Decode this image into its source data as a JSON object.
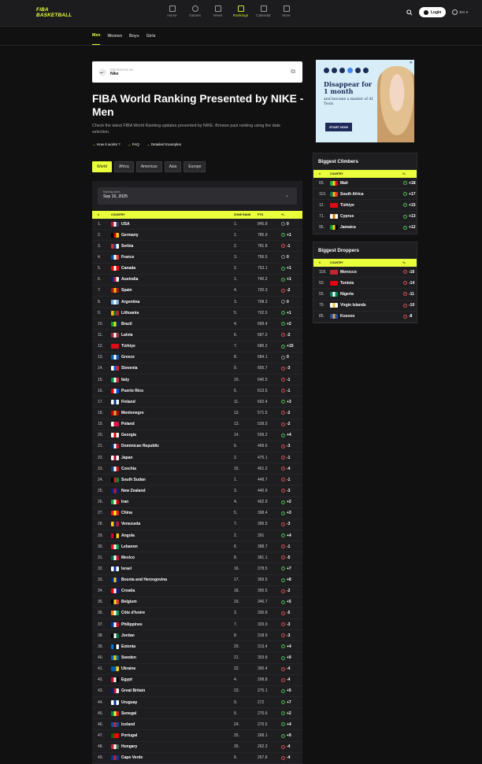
{
  "brand": {
    "line1": "FIBA",
    "line2": "BASKETBALL"
  },
  "nav": [
    {
      "label": "Home",
      "icon": "home-icon"
    },
    {
      "label": "Games",
      "icon": "ball-icon"
    },
    {
      "label": "News",
      "icon": "news-icon"
    },
    {
      "label": "Rankings",
      "icon": "rankings-icon",
      "active": true
    },
    {
      "label": "Calendar",
      "icon": "calendar-icon"
    },
    {
      "label": "More",
      "icon": "more-icon"
    }
  ],
  "header": {
    "login_label": "Login",
    "lang_label": "EN"
  },
  "subnav": [
    {
      "label": "Men",
      "active": true
    },
    {
      "label": "Women"
    },
    {
      "label": "Boys"
    },
    {
      "label": "Girls"
    }
  ],
  "sponsor": {
    "label": "PRESENTED BY",
    "name": "Nike"
  },
  "page": {
    "title": "FIBA World Ranking Presented by NIKE - Men",
    "description": "Check the latest FIBA World Ranking updates presented by NIKE. Browse past ranking using the date selection.",
    "links": [
      "How it works ?",
      "FAQ",
      "Detailed Examples"
    ]
  },
  "regions": [
    {
      "label": "World",
      "active": true
    },
    {
      "label": "Africa"
    },
    {
      "label": "Americas"
    },
    {
      "label": "Asia"
    },
    {
      "label": "Europe"
    }
  ],
  "ranking_date": {
    "label": "Ranking dates",
    "value": "Sep 15, 2025"
  },
  "table": {
    "headers": [
      "#",
      "COUNTRY",
      "ZONE RANK",
      "PTS",
      "+/-"
    ],
    "rows": [
      {
        "rank": "1.",
        "country": "USA",
        "zone": "1.",
        "pts": "845.8",
        "chg": "0",
        "flag": [
          "#b22234",
          "#ffffff",
          "#3c3b6e"
        ]
      },
      {
        "rank": "2.",
        "country": "Germany",
        "zone": "1.",
        "pts": "785.9",
        "chg": "+1",
        "flag": [
          "#000000",
          "#dd0000",
          "#ffce00"
        ]
      },
      {
        "rank": "3.",
        "country": "Serbia",
        "zone": "2.",
        "pts": "781.8",
        "chg": "-1",
        "flag": [
          "#c6363c",
          "#0c4076",
          "#ffffff"
        ]
      },
      {
        "rank": "4.",
        "country": "France",
        "zone": "3.",
        "pts": "756.5",
        "chg": "0",
        "flag": [
          "#0055a4",
          "#ffffff",
          "#ef4135"
        ]
      },
      {
        "rank": "5.",
        "country": "Canada",
        "zone": "2.",
        "pts": "753.1",
        "chg": "+1",
        "flag": [
          "#ff0000",
          "#ffffff",
          "#ff0000"
        ]
      },
      {
        "rank": "6.",
        "country": "Australia",
        "zone": "1.",
        "pts": "740.2",
        "chg": "+1",
        "flag": [
          "#00247d",
          "#cf142b",
          "#ffffff"
        ]
      },
      {
        "rank": "7.",
        "country": "Spain",
        "zone": "4.",
        "pts": "720.3",
        "chg": "-2",
        "flag": [
          "#aa151b",
          "#f1bf00",
          "#aa151b"
        ]
      },
      {
        "rank": "8.",
        "country": "Argentina",
        "zone": "3.",
        "pts": "708.3",
        "chg": "0",
        "flag": [
          "#74acdf",
          "#ffffff",
          "#74acdf"
        ]
      },
      {
        "rank": "9.",
        "country": "Lithuania",
        "zone": "5.",
        "pts": "702.5",
        "chg": "+1",
        "flag": [
          "#fdb913",
          "#006a44",
          "#c1272d"
        ]
      },
      {
        "rank": "10.",
        "country": "Brazil",
        "zone": "4.",
        "pts": "699.4",
        "chg": "+2",
        "flag": [
          "#009c3b",
          "#ffdf00",
          "#002776"
        ]
      },
      {
        "rank": "11.",
        "country": "Latvia",
        "zone": "6.",
        "pts": "687.2",
        "chg": "-2",
        "flag": [
          "#9e3039",
          "#ffffff",
          "#9e3039"
        ]
      },
      {
        "rank": "12.",
        "country": "Türkiye",
        "zone": "7.",
        "pts": "686.2",
        "chg": "+15",
        "flag": [
          "#e30a17",
          "#e30a17",
          "#e30a17"
        ]
      },
      {
        "rank": "13.",
        "country": "Greece",
        "zone": "8.",
        "pts": "684.1",
        "chg": "0",
        "flag": [
          "#0d5eaf",
          "#ffffff",
          "#0d5eaf"
        ]
      },
      {
        "rank": "14.",
        "country": "Slovenia",
        "zone": "9.",
        "pts": "655.7",
        "chg": "-3",
        "flag": [
          "#ffffff",
          "#005ce5",
          "#ed1c24"
        ]
      },
      {
        "rank": "15.",
        "country": "Italy",
        "zone": "10.",
        "pts": "640.5",
        "chg": "-1",
        "flag": [
          "#009246",
          "#ffffff",
          "#ce2b37"
        ]
      },
      {
        "rank": "16.",
        "country": "Puerto Rico",
        "zone": "5.",
        "pts": "613.5",
        "chg": "-1",
        "flag": [
          "#ed0000",
          "#ffffff",
          "#0050f0"
        ]
      },
      {
        "rank": "17.",
        "country": "Finland",
        "zone": "11.",
        "pts": "602.4",
        "chg": "+3",
        "flag": [
          "#ffffff",
          "#003580",
          "#ffffff"
        ]
      },
      {
        "rank": "18.",
        "country": "Montenegro",
        "zone": "12.",
        "pts": "571.5",
        "chg": "-2",
        "flag": [
          "#c40308",
          "#d4af37",
          "#c40308"
        ]
      },
      {
        "rank": "19.",
        "country": "Poland",
        "zone": "13.",
        "pts": "539.5",
        "chg": "-2",
        "flag": [
          "#ffffff",
          "#dc143c",
          "#dc143c"
        ]
      },
      {
        "rank": "20.",
        "country": "Georgia",
        "zone": "14.",
        "pts": "509.2",
        "chg": "+4",
        "flag": [
          "#ffffff",
          "#ff0000",
          "#ffffff"
        ]
      },
      {
        "rank": "21.",
        "country": "Dominican Republic",
        "zone": "6.",
        "pts": "499.6",
        "chg": "-3",
        "flag": [
          "#002d62",
          "#ffffff",
          "#ce1126"
        ]
      },
      {
        "rank": "22.",
        "country": "Japan",
        "zone": "2.",
        "pts": "475.1",
        "chg": "-1",
        "flag": [
          "#ffffff",
          "#bc002d",
          "#ffffff"
        ]
      },
      {
        "rank": "23.",
        "country": "Czechia",
        "zone": "15.",
        "pts": "451.2",
        "chg": "-4",
        "flag": [
          "#11457e",
          "#ffffff",
          "#d7141a"
        ]
      },
      {
        "rank": "24.",
        "country": "South Sudan",
        "zone": "1.",
        "pts": "448.7",
        "chg": "-1",
        "flag": [
          "#000000",
          "#da121a",
          "#078930"
        ]
      },
      {
        "rank": "25.",
        "country": "New Zealand",
        "zone": "3.",
        "pts": "440.9",
        "chg": "-3",
        "flag": [
          "#00247d",
          "#cc142b",
          "#00247d"
        ]
      },
      {
        "rank": "26.",
        "country": "Iran",
        "zone": "4.",
        "pts": "402.9",
        "chg": "+2",
        "flag": [
          "#239f40",
          "#ffffff",
          "#da0000"
        ]
      },
      {
        "rank": "27.",
        "country": "China",
        "zone": "5.",
        "pts": "398.4",
        "chg": "+3",
        "flag": [
          "#ee1c25",
          "#ffff00",
          "#ee1c25"
        ]
      },
      {
        "rank": "28.",
        "country": "Venezuela",
        "zone": "7.",
        "pts": "395.5",
        "chg": "-3",
        "flag": [
          "#ffcc00",
          "#00247d",
          "#cf142b"
        ]
      },
      {
        "rank": "29.",
        "country": "Angola",
        "zone": "2.",
        "pts": "391",
        "chg": "+4",
        "flag": [
          "#cc092f",
          "#000000",
          "#ffcb00"
        ]
      },
      {
        "rank": "30.",
        "country": "Lebanon",
        "zone": "6.",
        "pts": "388.7",
        "chg": "-1",
        "flag": [
          "#ee161f",
          "#ffffff",
          "#00a651"
        ]
      },
      {
        "rank": "31.",
        "country": "Mexico",
        "zone": "8.",
        "pts": "381.1",
        "chg": "-5",
        "flag": [
          "#006847",
          "#ffffff",
          "#ce1126"
        ]
      },
      {
        "rank": "32.",
        "country": "Israel",
        "zone": "16.",
        "pts": "378.5",
        "chg": "+7",
        "flag": [
          "#ffffff",
          "#0038b8",
          "#ffffff"
        ]
      },
      {
        "rank": "33.",
        "country": "Bosnia and Herzegovina",
        "zone": "17.",
        "pts": "369.5",
        "chg": "+8",
        "flag": [
          "#002395",
          "#fecb00",
          "#002395"
        ]
      },
      {
        "rank": "34.",
        "country": "Croatia",
        "zone": "18.",
        "pts": "350.5",
        "chg": "-2",
        "flag": [
          "#ff0000",
          "#ffffff",
          "#171796"
        ]
      },
      {
        "rank": "35.",
        "country": "Belgium",
        "zone": "19.",
        "pts": "346.7",
        "chg": "+5",
        "flag": [
          "#000000",
          "#fdda24",
          "#ef3340"
        ]
      },
      {
        "rank": "36.",
        "country": "Côte d'Ivoire",
        "zone": "3.",
        "pts": "330.8",
        "chg": "-5",
        "flag": [
          "#f77f00",
          "#ffffff",
          "#009e60"
        ]
      },
      {
        "rank": "37.",
        "country": "Philippines",
        "zone": "7.",
        "pts": "329.9",
        "chg": "-3",
        "flag": [
          "#0038a8",
          "#ffffff",
          "#ce1126"
        ]
      },
      {
        "rank": "38.",
        "country": "Jordan",
        "zone": "8.",
        "pts": "318.9",
        "chg": "-3",
        "flag": [
          "#000000",
          "#ffffff",
          "#007a3d"
        ]
      },
      {
        "rank": "39.",
        "country": "Estonia",
        "zone": "20.",
        "pts": "313.4",
        "chg": "+4",
        "flag": [
          "#0072ce",
          "#000000",
          "#ffffff"
        ]
      },
      {
        "rank": "40.",
        "country": "Sweden",
        "zone": "21.",
        "pts": "303.8",
        "chg": "+9",
        "flag": [
          "#006aa7",
          "#fecc00",
          "#006aa7"
        ]
      },
      {
        "rank": "41.",
        "country": "Ukraine",
        "zone": "22.",
        "pts": "300.4",
        "chg": "-4",
        "flag": [
          "#0057b7",
          "#0057b7",
          "#ffd700"
        ]
      },
      {
        "rank": "42.",
        "country": "Egypt",
        "zone": "4.",
        "pts": "298.8",
        "chg": "-4",
        "flag": [
          "#ce1126",
          "#ffffff",
          "#000000"
        ]
      },
      {
        "rank": "43.",
        "country": "Great Britain",
        "zone": "23.",
        "pts": "275.1",
        "chg": "+5",
        "flag": [
          "#012169",
          "#c8102e",
          "#ffffff"
        ]
      },
      {
        "rank": "44.",
        "country": "Uruguay",
        "zone": "9.",
        "pts": "272",
        "chg": "+7",
        "flag": [
          "#ffffff",
          "#0038a8",
          "#ffffff"
        ]
      },
      {
        "rank": "45.",
        "country": "Senegal",
        "zone": "5.",
        "pts": "270.6",
        "chg": "+2",
        "flag": [
          "#00853f",
          "#fdef42",
          "#e31b23"
        ]
      },
      {
        "rank": "46.",
        "country": "Iceland",
        "zone": "24.",
        "pts": "270.5",
        "chg": "+4",
        "flag": [
          "#02529c",
          "#dc1e35",
          "#02529c"
        ]
      },
      {
        "rank": "47.",
        "country": "Portugal",
        "zone": "25.",
        "pts": "268.1",
        "chg": "+9",
        "flag": [
          "#006600",
          "#ff0000",
          "#ff0000"
        ]
      },
      {
        "rank": "48.",
        "country": "Hungary",
        "zone": "26.",
        "pts": "262.3",
        "chg": "-4",
        "flag": [
          "#ce2939",
          "#ffffff",
          "#477050"
        ]
      },
      {
        "rank": "49.",
        "country": "Cape Verde",
        "zone": "6.",
        "pts": "257.8",
        "chg": "-4",
        "flag": [
          "#003893",
          "#cf2027",
          "#003893"
        ]
      }
    ]
  },
  "climbers": {
    "title": "Biggest Climbers",
    "headers": [
      "#",
      "COUNTRY",
      "+/-"
    ],
    "rows": [
      {
        "rank": "65.",
        "country": "Mali",
        "chg": "+18",
        "flag": [
          "#14b53a",
          "#fcd116",
          "#ce1126"
        ]
      },
      {
        "rank": "110.",
        "country": "South Africa",
        "chg": "+17",
        "flag": [
          "#007a4d",
          "#ffb612",
          "#de3831"
        ]
      },
      {
        "rank": "12.",
        "country": "Türkiye",
        "chg": "+15",
        "flag": [
          "#e30a17",
          "#e30a17",
          "#e30a17"
        ]
      },
      {
        "rank": "71.",
        "country": "Cyprus",
        "chg": "+13",
        "flag": [
          "#ffffff",
          "#d57800",
          "#ffffff"
        ]
      },
      {
        "rank": "95.",
        "country": "Jamaica",
        "chg": "+12",
        "flag": [
          "#009b3a",
          "#fed100",
          "#000000"
        ]
      }
    ]
  },
  "droppers": {
    "title": "Biggest Droppers",
    "headers": [
      "#",
      "COUNTRY",
      "+/-"
    ],
    "rows": [
      {
        "rank": "118.",
        "country": "Morocco",
        "chg": "-16",
        "flag": [
          "#c1272d",
          "#c1272d",
          "#c1272d"
        ]
      },
      {
        "rank": "50.",
        "country": "Tunisia",
        "chg": "-14",
        "flag": [
          "#e70013",
          "#e70013",
          "#e70013"
        ]
      },
      {
        "rank": "55.",
        "country": "Nigeria",
        "chg": "-11",
        "flag": [
          "#008751",
          "#ffffff",
          "#008751"
        ]
      },
      {
        "rank": "79.",
        "country": "Virgin Islands",
        "chg": "-10",
        "flag": [
          "#ffffff",
          "#f4c430",
          "#ffffff"
        ]
      },
      {
        "rank": "85.",
        "country": "Kosovo",
        "chg": "-8",
        "flag": [
          "#244aa5",
          "#d0a650",
          "#244aa5"
        ]
      }
    ]
  },
  "ad": {
    "headline": "Disappear for 1 month",
    "subline": "and become a master of AI Tools",
    "button": "START NOW"
  }
}
